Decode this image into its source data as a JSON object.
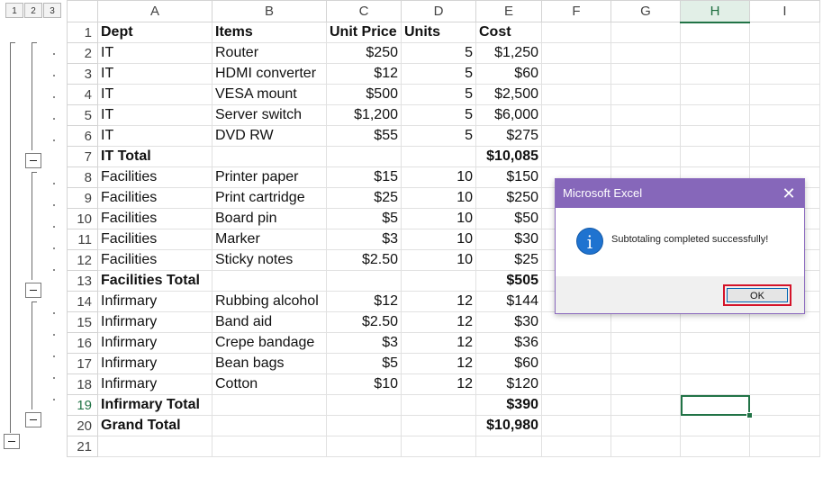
{
  "outline": {
    "levels": [
      "1",
      "2",
      "3"
    ]
  },
  "columns": [
    "A",
    "B",
    "C",
    "D",
    "E",
    "F",
    "G",
    "H",
    "I"
  ],
  "selected_column": "H",
  "selected_row": "19",
  "rows": [
    {
      "n": "1",
      "a": "Dept",
      "b": "Items",
      "c": "Unit Price",
      "d": "Units",
      "e": "Cost",
      "bold": false,
      "header": true
    },
    {
      "n": "2",
      "a": "IT",
      "b": "Router",
      "c": "$250",
      "d": "5",
      "e": "$1,250"
    },
    {
      "n": "3",
      "a": "IT",
      "b": "HDMI converter",
      "c": "$12",
      "d": "5",
      "e": "$60"
    },
    {
      "n": "4",
      "a": "IT",
      "b": "VESA mount",
      "c": "$500",
      "d": "5",
      "e": "$2,500"
    },
    {
      "n": "5",
      "a": "IT",
      "b": "Server switch",
      "c": "$1,200",
      "d": "5",
      "e": "$6,000"
    },
    {
      "n": "6",
      "a": "IT",
      "b": "DVD RW",
      "c": "$55",
      "d": "5",
      "e": "$275"
    },
    {
      "n": "7",
      "a": "IT Total",
      "b": "",
      "c": "",
      "d": "",
      "e": "$10,085",
      "bold": true
    },
    {
      "n": "8",
      "a": "Facilities",
      "b": "Printer paper",
      "c": "$15",
      "d": "10",
      "e": "$150"
    },
    {
      "n": "9",
      "a": "Facilities",
      "b": "Print cartridge",
      "c": "$25",
      "d": "10",
      "e": "$250"
    },
    {
      "n": "10",
      "a": "Facilities",
      "b": "Board pin",
      "c": "$5",
      "d": "10",
      "e": "$50"
    },
    {
      "n": "11",
      "a": "Facilities",
      "b": "Marker",
      "c": "$3",
      "d": "10",
      "e": "$30"
    },
    {
      "n": "12",
      "a": "Facilities",
      "b": "Sticky notes",
      "c": "$2.50",
      "d": "10",
      "e": "$25"
    },
    {
      "n": "13",
      "a": "Facilities Total",
      "b": "",
      "c": "",
      "d": "",
      "e": "$505",
      "bold": true
    },
    {
      "n": "14",
      "a": "Infirmary",
      "b": "Rubbing alcohol",
      "c": "$12",
      "d": "12",
      "e": "$144"
    },
    {
      "n": "15",
      "a": "Infirmary",
      "b": "Band aid",
      "c": "$2.50",
      "d": "12",
      "e": "$30"
    },
    {
      "n": "16",
      "a": "Infirmary",
      "b": "Crepe bandage",
      "c": "$3",
      "d": "12",
      "e": "$36"
    },
    {
      "n": "17",
      "a": "Infirmary",
      "b": "Bean bags",
      "c": "$5",
      "d": "12",
      "e": "$60"
    },
    {
      "n": "18",
      "a": "Infirmary",
      "b": "Cotton",
      "c": "$10",
      "d": "12",
      "e": "$120"
    },
    {
      "n": "19",
      "a": "Infirmary Total",
      "b": "",
      "c": "",
      "d": "",
      "e": "$390",
      "bold": true
    },
    {
      "n": "20",
      "a": "Grand Total",
      "b": "",
      "c": "",
      "d": "",
      "e": "$10,980",
      "bold": true
    },
    {
      "n": "21",
      "a": "",
      "b": "",
      "c": "",
      "d": "",
      "e": ""
    }
  ],
  "dialog": {
    "title": "Microsoft Excel",
    "close_glyph": "✕",
    "icon_glyph": "i",
    "message": "Subtotaling completed successfully!",
    "ok_label": "OK"
  },
  "colors": {
    "excel_green": "#217346",
    "dialog_title_bg": "#8667ba",
    "info_blue": "#1f73d0",
    "highlight_red": "#d4142a"
  }
}
